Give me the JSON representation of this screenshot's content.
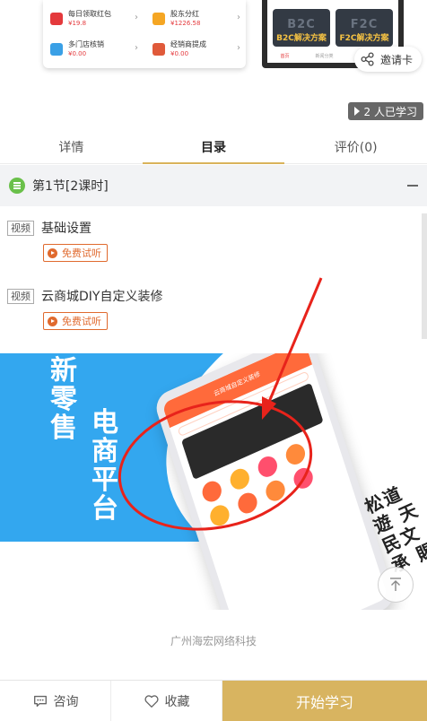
{
  "preview": {
    "grid": [
      {
        "name": "每日领取红包",
        "value": "¥19.8",
        "icon_color": "#e4393c",
        "icon": "red-envelope-icon"
      },
      {
        "name": "股东分红",
        "value": "¥1226.58",
        "icon_color": "#f5a623",
        "icon": "dividend-icon"
      },
      {
        "name": "多门店核销",
        "value": "¥0.00",
        "icon_color": "#3aa0e6",
        "icon": "store-icon"
      },
      {
        "name": "经销商提成",
        "value": "¥0.00",
        "icon_color": "#e05a3a",
        "icon": "dealer-icon"
      }
    ],
    "phone_cards": [
      {
        "big": "B2C",
        "label": "B2C解决方案"
      },
      {
        "big": "F2C",
        "label": "F2C解决方案"
      }
    ],
    "phone_tabbar": [
      "首页",
      "新闻分类",
      "",
      ""
    ]
  },
  "invite": {
    "label": "邀请卡"
  },
  "learners": {
    "label": "2 人已学习"
  },
  "tabs": [
    {
      "label": "详情",
      "active": false
    },
    {
      "label": "目录",
      "active": true
    },
    {
      "label": "评价(0)",
      "active": false
    }
  ],
  "section": {
    "title": "第1节[2课时]"
  },
  "lessons": [
    {
      "tag": "视频",
      "title": "基础设置",
      "free_label": "免费试听"
    },
    {
      "tag": "视频",
      "title": "云商城DIY自定义装修",
      "free_label": "免费试听"
    }
  ],
  "banner": {
    "text_col1": "新零售",
    "text_col2": "电商平台",
    "device_title": "云商城自定义装修",
    "calligraphy": "松道遊 天 民文 承 賜"
  },
  "company": "广州海宏网络科技",
  "bottombar": {
    "consult": "咨询",
    "favorite": "收藏",
    "start": "开始学习"
  },
  "colors": {
    "accent": "#d8b460",
    "free_orange": "#e06a2e",
    "section_green": "#6ac04a",
    "banner_blue": "#33a7ef",
    "annotation_red": "#e8231b"
  }
}
